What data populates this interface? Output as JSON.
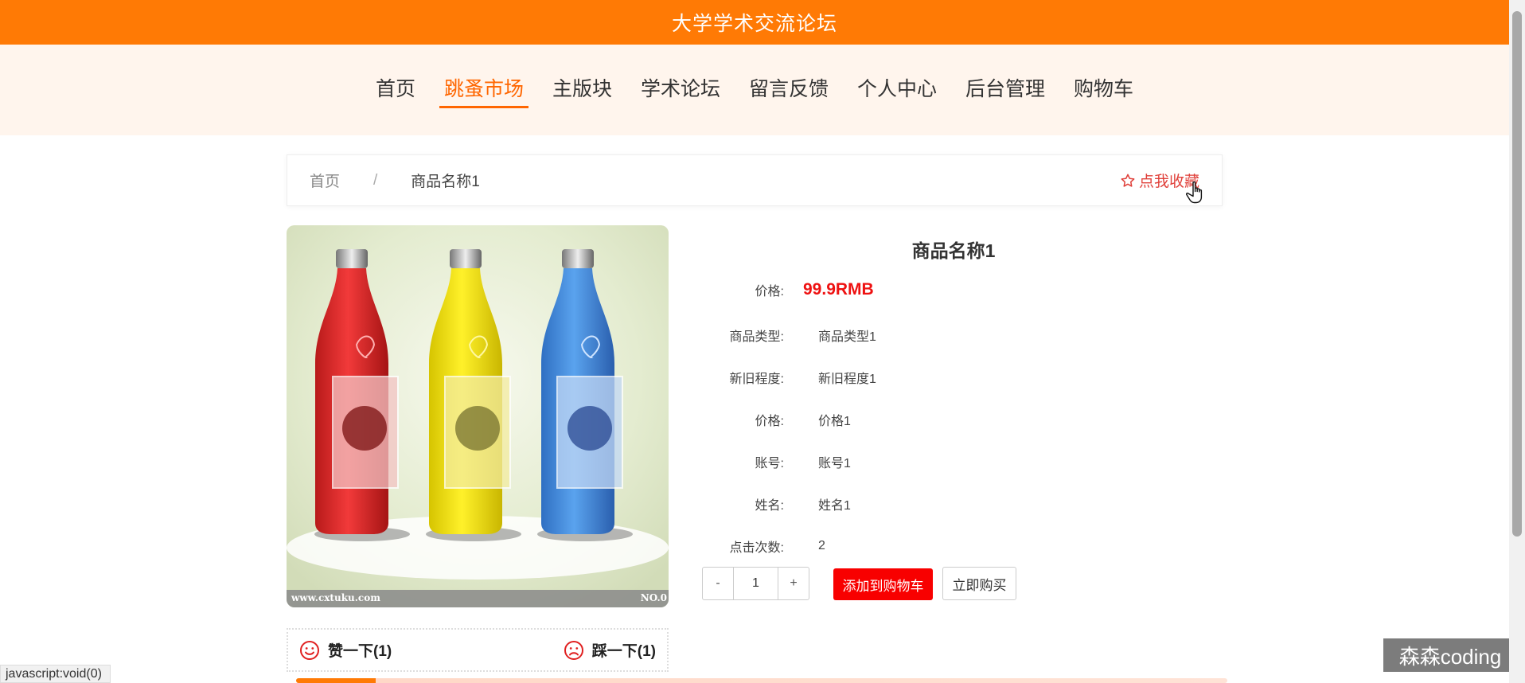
{
  "header": {
    "site_title": "大学学术交流论坛"
  },
  "nav": {
    "items": [
      {
        "label": "首页",
        "active": false
      },
      {
        "label": "跳蚤市场",
        "active": true
      },
      {
        "label": "主版块",
        "active": false
      },
      {
        "label": "学术论坛",
        "active": false
      },
      {
        "label": "留言反馈",
        "active": false
      },
      {
        "label": "个人中心",
        "active": false
      },
      {
        "label": "后台管理",
        "active": false
      },
      {
        "label": "购物车",
        "active": false
      }
    ]
  },
  "breadcrumb": {
    "home": "首页",
    "separator": "/",
    "current": "商品名称1"
  },
  "favorite": {
    "label": "点我收藏",
    "icon": "star-outline-icon"
  },
  "product": {
    "title": "商品名称1",
    "price_label": "价格:",
    "price_value": "99.9RMB",
    "fields": [
      {
        "label": "商品类型:",
        "value": "商品类型1"
      },
      {
        "label": "新旧程度:",
        "value": "新旧程度1"
      },
      {
        "label": "价格:",
        "value": "价格1"
      },
      {
        "label": "账号:",
        "value": "账号1"
      },
      {
        "label": "姓名:",
        "value": "姓名1"
      },
      {
        "label": "点击次数:",
        "value": "2"
      }
    ],
    "image_text_left": "www.cxtuku.com",
    "image_text_right": "NO.0"
  },
  "votes": {
    "like_label": "赞一下(1)",
    "dislike_label": "踩一下(1)",
    "like_icon": "smile-icon",
    "dislike_icon": "frown-icon"
  },
  "actions": {
    "minus": "-",
    "quantity": "1",
    "plus": "+",
    "add_to_cart": "添加到购物车",
    "buy_now": "立即购买"
  },
  "status_bar": {
    "url": "javascript:void(0)"
  },
  "watermark": {
    "text": "森森coding"
  },
  "colors": {
    "brand": "#ff7a05",
    "active_nav": "#ff6600",
    "price": "#ee1111",
    "cart_button": "#f80000",
    "favorite": "#e0403a"
  }
}
